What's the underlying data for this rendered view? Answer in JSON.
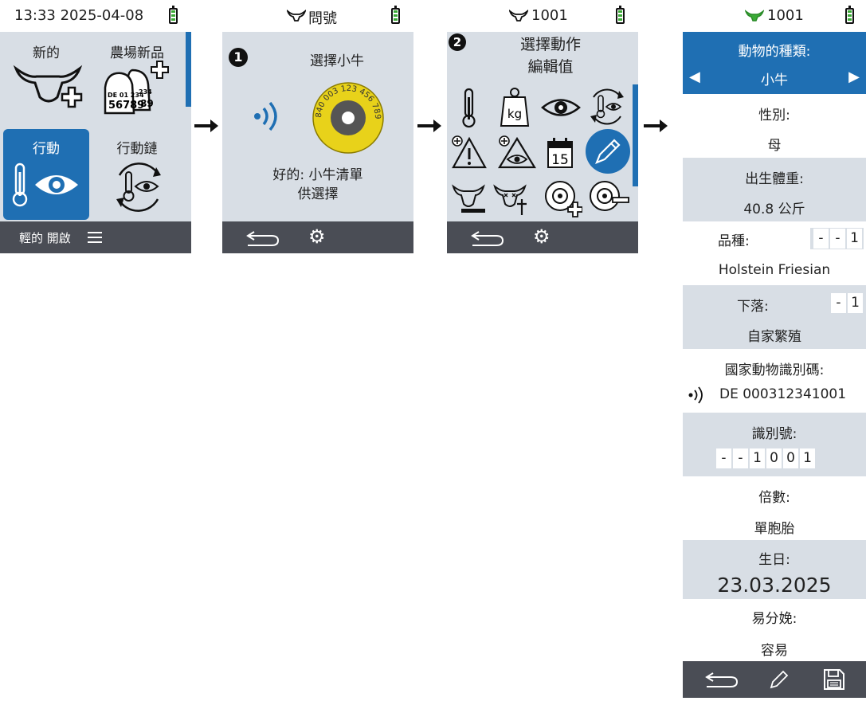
{
  "screen1": {
    "status_time": "13:33 2025-04-08",
    "tiles": {
      "new": "新的",
      "farm_new": "農場新品",
      "action": "行動",
      "action_chain": "行動鏈"
    },
    "tag_lines": [
      "DE 01 234",
      "56789",
      "234",
      "89"
    ],
    "bottom_label": "輕的 開啟",
    "colors": {
      "accent": "#1f6fb3",
      "panel": "#d8dee5",
      "bar": "#4a4d55"
    }
  },
  "screen2": {
    "title": "問號",
    "step_number": "1",
    "instruction": "選擇小牛",
    "tag_number": "840 003 123 456 789",
    "hint_line1": "好的: 小牛清單",
    "hint_line2": "供選擇"
  },
  "screen3": {
    "title": "1001",
    "step_number": "2",
    "instruction_line1": "選擇動作",
    "instruction_line2": "編輯值",
    "icons": [
      "thermometer-icon",
      "weight-kg-icon",
      "eye-icon",
      "cycle-icon",
      "alert-plus-icon",
      "eye-alert-plus-icon",
      "calendar-icon",
      "pencil-icon",
      "cow-minus-icon",
      "cow-death-icon",
      "tag-plus-icon",
      "tag-minus-icon"
    ],
    "weight_unit": "kg",
    "calendar_day": "15"
  },
  "screen4": {
    "title": "1001",
    "animal_type_label": "動物的種類:",
    "animal_type_value": "小牛",
    "gender_label": "性別:",
    "gender_value": "母",
    "birth_weight_label": "出生體重:",
    "birth_weight_value": "40.8 公斤",
    "breed_label": "品種:",
    "breed_code": [
      "-",
      "-",
      "1"
    ],
    "breed_value": "Holstein Friesian",
    "origin_label": "下落:",
    "origin_code": [
      "-",
      "1"
    ],
    "origin_value": "自家繁殖",
    "national_id_label": "國家動物識別碼:",
    "national_id_value": "DE 000312341001",
    "id_label": "識別號:",
    "id_digits": [
      "-",
      "-",
      "1",
      "0",
      "0",
      "1"
    ],
    "multiple_label": "倍數:",
    "multiple_value": "單胞胎",
    "birthday_label": "生日:",
    "birthday_value": "23.03.2025",
    "calving_label": "易分娩:",
    "calving_value": "容易"
  }
}
